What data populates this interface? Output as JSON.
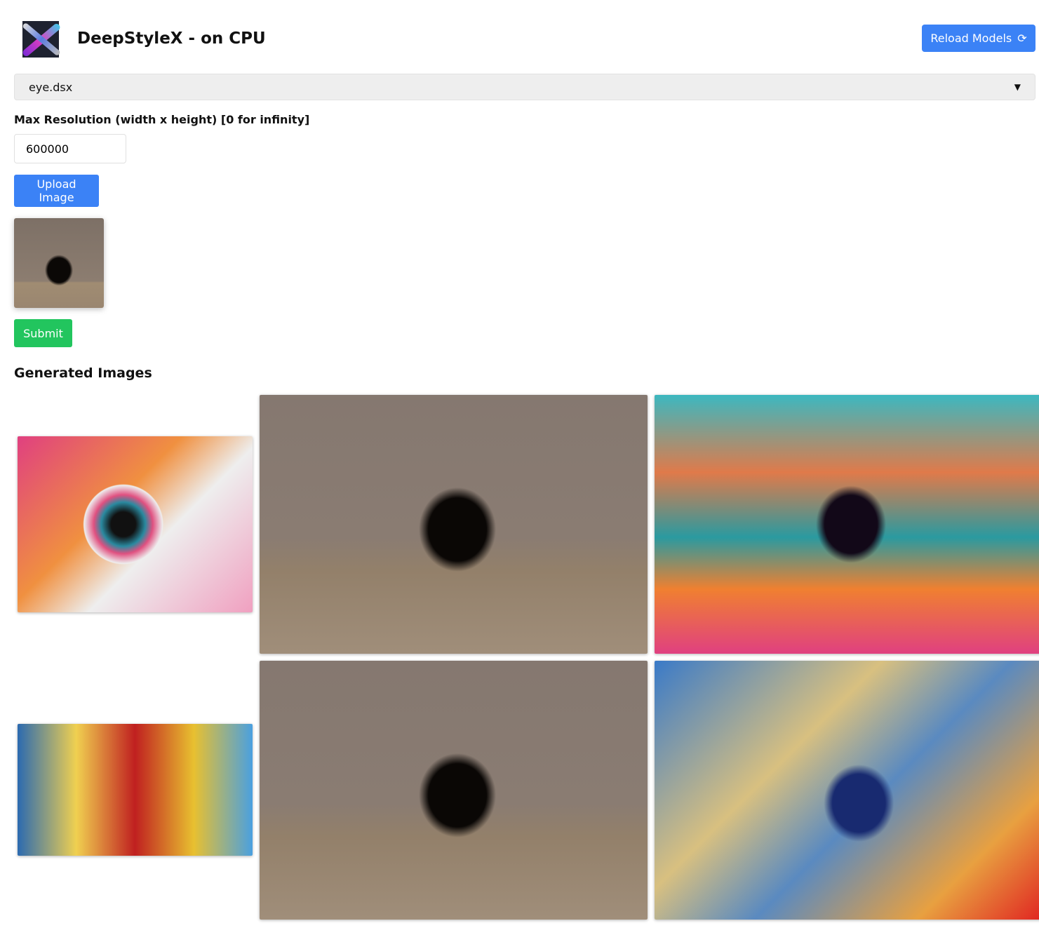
{
  "header": {
    "title": "DeepStyleX - on CPU",
    "reload_label": "Reload Models",
    "logo_text": "X"
  },
  "model_select": {
    "value": "eye.dsx"
  },
  "resolution": {
    "label": "Max Resolution (width x height) [0 for infinity]",
    "value": "600000"
  },
  "upload_label": "Upload Image",
  "submit_label": "Submit",
  "generated": {
    "heading": "Generated Images"
  }
}
